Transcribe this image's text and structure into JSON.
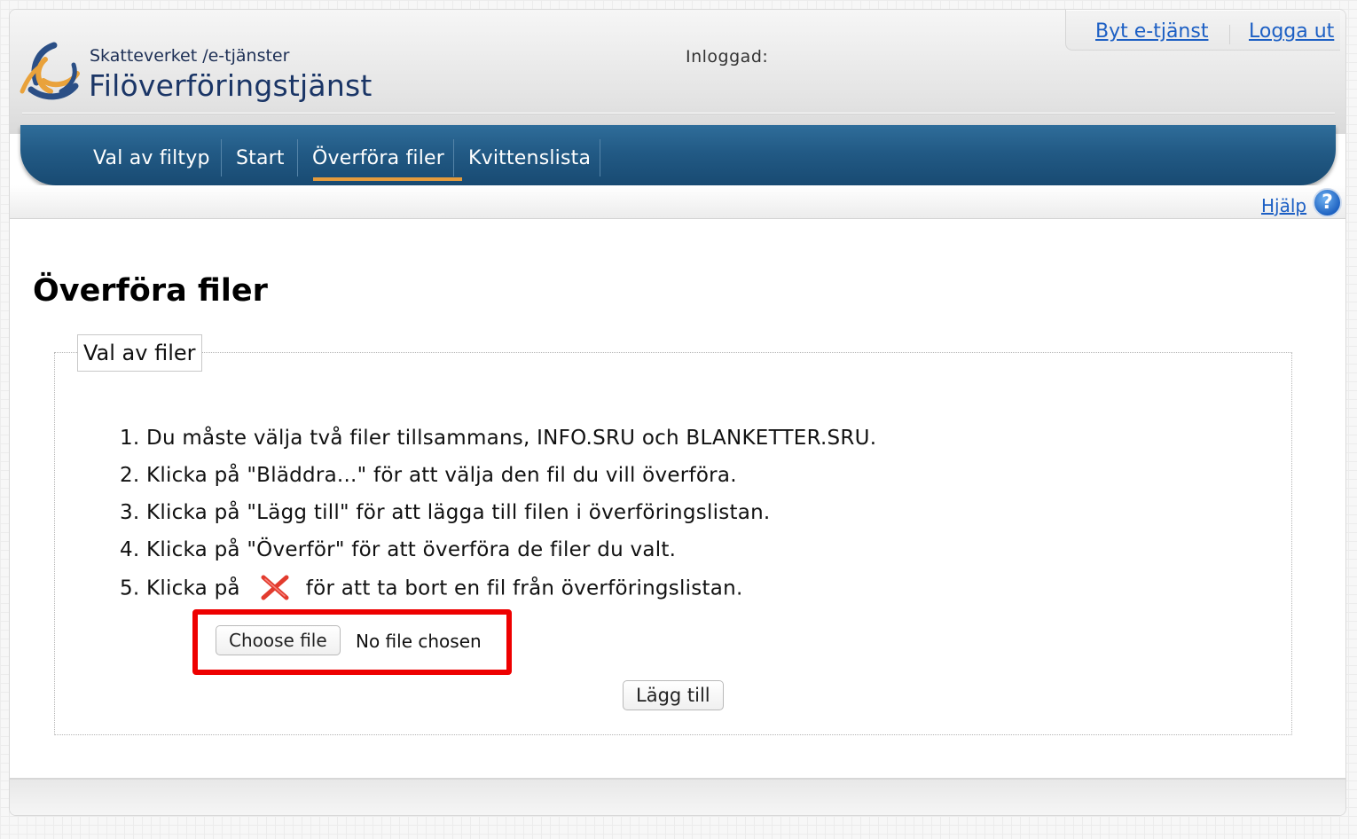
{
  "header": {
    "org_name": "Skatteverket /e-tjänster",
    "service_name": "Filöverföringstjänst",
    "logged_in_label": "Inloggad:",
    "links": {
      "switch_service": "Byt e-tjänst",
      "logout": "Logga ut"
    }
  },
  "nav": {
    "items": [
      {
        "label": "Val av filtyp"
      },
      {
        "label": "Start"
      },
      {
        "label": "Överföra filer",
        "active": true
      },
      {
        "label": "Kvittenslista"
      }
    ],
    "active_color": "#e49b3c"
  },
  "help": {
    "label": "Hjälp",
    "icon_glyph": "?",
    "icon": "help-icon"
  },
  "main": {
    "title": "Överföra filer",
    "fieldset_legend": "Val av filer",
    "steps": [
      "1. Du måste välja två filer tillsammans, INFO.SRU och BLANKETTER.SRU.",
      "2. Klicka på \"Bläddra...\" för att välja den fil du vill överföra.",
      "3. Klicka på \"Lägg till\" för att lägga till filen i överföringslistan.",
      "4. Klicka på \"Överför\" för att överföra de filer du valt."
    ],
    "step5_prefix": "5. Klicka på",
    "step5_suffix": "för att ta bort en fil från överföringslistan.",
    "step5_icon": "remove-x-icon",
    "file_input": {
      "button_label": "Choose file",
      "status": "No file chosen"
    },
    "add_button": "Lägg till",
    "highlight_color": "#ee0000"
  }
}
